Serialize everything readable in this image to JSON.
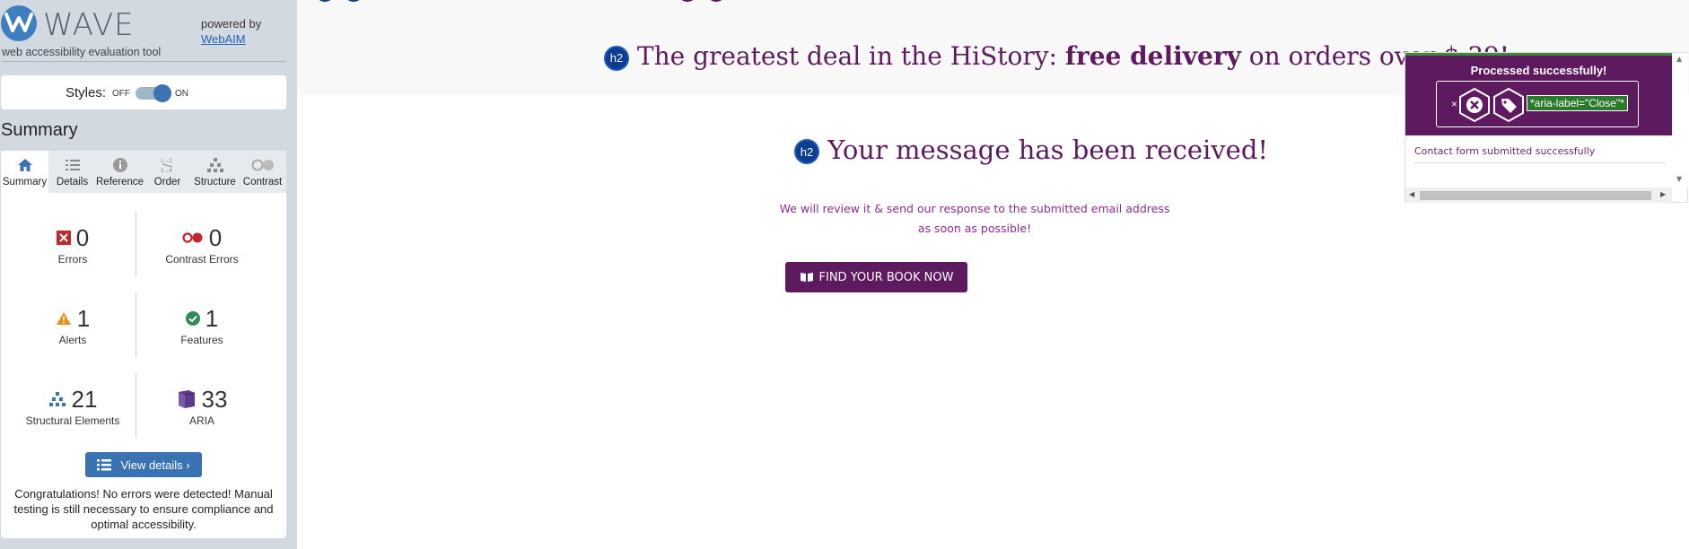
{
  "wave": {
    "name": "WAVE",
    "subtitle": "web accessibility evaluation tool",
    "powered_by": "powered by",
    "webaim": "WebAIM",
    "styles_label": "Styles:",
    "styles_off": "OFF",
    "styles_on": "ON",
    "summary_heading": "Summary",
    "tabs": [
      {
        "label": "Summary",
        "icon": "home-icon"
      },
      {
        "label": "Details",
        "icon": "list-icon"
      },
      {
        "label": "Reference",
        "icon": "info-icon"
      },
      {
        "label": "Order",
        "icon": "order-icon"
      },
      {
        "label": "Structure",
        "icon": "structure-icon"
      },
      {
        "label": "Contrast",
        "icon": "contrast-icon"
      }
    ],
    "stats": {
      "errors": {
        "value": "0",
        "label": "Errors"
      },
      "contrast": {
        "value": "0",
        "label": "Contrast Errors"
      },
      "alerts": {
        "value": "1",
        "label": "Alerts"
      },
      "features": {
        "value": "1",
        "label": "Features"
      },
      "structural": {
        "value": "21",
        "label": "Structural Elements"
      },
      "aria": {
        "value": "33",
        "label": "ARIA"
      }
    },
    "view_details": "View details ›",
    "congrats": "Congratulations! No errors were detected! Manual testing is still necessary to ensure compliance and optimal accessibility."
  },
  "page": {
    "h2_badge": "h2",
    "promo_prefix": "The greatest deal in the HiStory: ",
    "promo_bold": "free delivery",
    "promo_suffix": " on orders over $ 39!",
    "received": "Your message has been received!",
    "review": "We will review it & send our response to the submitted email address as soon as possible!",
    "find_book": "FIND YOUR BOOK NOW"
  },
  "toast": {
    "title": "Processed successfully!",
    "close": "×",
    "aria_chip": "*aria-label=\"Close\"*",
    "message": "Contact form submitted successfully"
  },
  "colors": {
    "brand_purple": "#5e1a5e",
    "wave_blue": "#3973b4",
    "h2_blue": "#0b3d91"
  }
}
